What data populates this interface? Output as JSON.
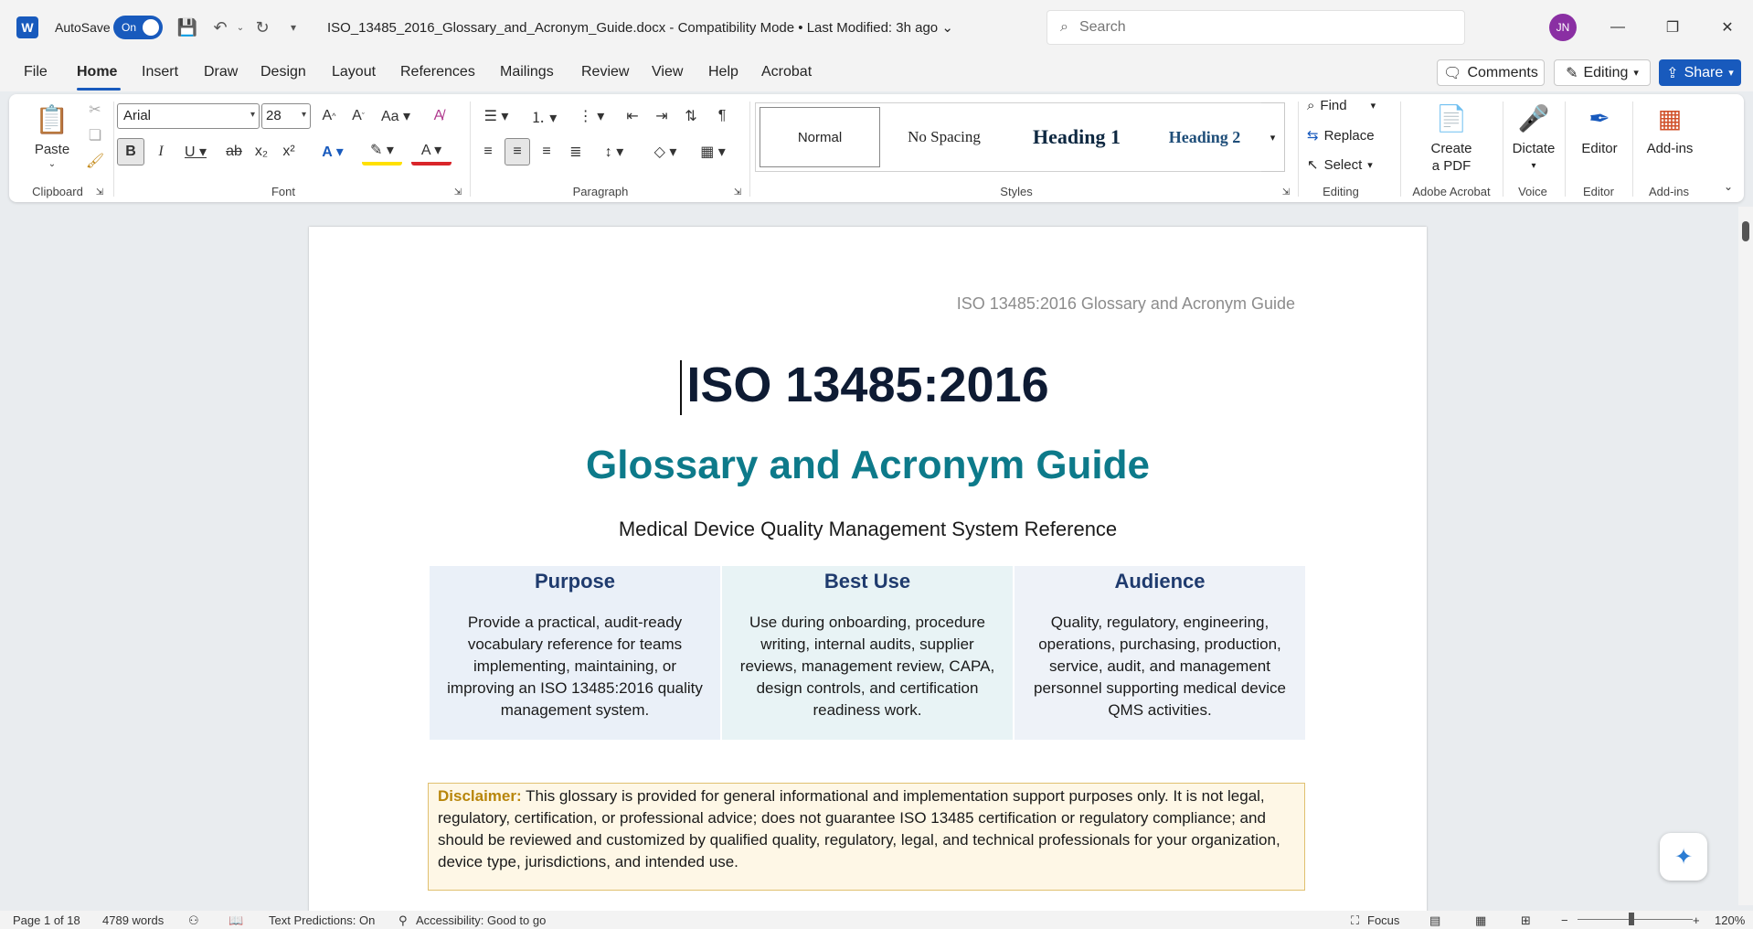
{
  "titlebar": {
    "autosave_label": "AutoSave",
    "autosave_state": "On",
    "document_name": "ISO_13485_2016_Glossary_and_Acronym_Guide.docx  -  Compatibility Mode  •  Last Modified: 3h ago",
    "search_placeholder": "Search",
    "user_initials": "JN"
  },
  "menu": {
    "tabs": [
      "File",
      "Home",
      "Insert",
      "Draw",
      "Design",
      "Layout",
      "References",
      "Mailings",
      "Review",
      "View",
      "Help",
      "Acrobat"
    ],
    "comments_label": "Comments",
    "editing_label": "Editing",
    "share_label": "Share"
  },
  "ribbon": {
    "clipboard": {
      "paste_label": "Paste",
      "group_label": "Clipboard"
    },
    "font": {
      "font_name": "Arial",
      "font_size": "28",
      "group_label": "Font"
    },
    "paragraph": {
      "group_label": "Paragraph"
    },
    "styles": {
      "items": [
        "Normal",
        "No Spacing",
        "Heading 1",
        "Heading 2"
      ],
      "group_label": "Styles"
    },
    "editing": {
      "find_label": "Find",
      "replace_label": "Replace",
      "select_label": "Select",
      "group_label": "Editing"
    },
    "acrobat": {
      "create_pdf_line1": "Create",
      "create_pdf_line2": "a PDF",
      "group_label": "Adobe Acrobat"
    },
    "voice": {
      "dictate_label": "Dictate",
      "group_label": "Voice"
    },
    "editor": {
      "editor_label": "Editor",
      "group_label": "Editor"
    },
    "addins": {
      "addins_label": "Add-ins",
      "group_label": "Add-ins"
    }
  },
  "document": {
    "running_header": "ISO 13485:2016 Glossary and Acronym Guide",
    "title": "ISO 13485:2016",
    "subtitle": "Glossary and Acronym Guide",
    "tagline": "Medical Device Quality Management System Reference",
    "info_cells": [
      {
        "heading": "Purpose",
        "body": "Provide a practical, audit-ready vocabulary reference for teams implementing, maintaining, or improving an ISO 13485:2016 quality management system.",
        "bg": "#eaf0f8"
      },
      {
        "heading": "Best Use",
        "body": "Use during onboarding, procedure writing, internal audits, supplier reviews, management review, CAPA, design controls, and certification readiness work.",
        "bg": "#e8f3f5"
      },
      {
        "heading": "Audience",
        "body": "Quality, regulatory, engineering, operations, purchasing, production, service, audit, and management personnel supporting medical device QMS activities.",
        "bg": "#eef2f8"
      }
    ],
    "disclaimer_label": "Disclaimer:",
    "disclaimer_text": " This glossary is provided for general informational and implementation support purposes only. It is not legal, regulatory, certification, or professional advice; does not guarantee ISO 13485 certification or regulatory compliance; and should be reviewed and customized by qualified quality, regulatory, legal, and technical professionals for your organization, device type, jurisdictions, and intended use."
  },
  "statusbar": {
    "page": "Page 1 of 18",
    "words": "4789 words",
    "text_predictions": "Text Predictions: On",
    "accessibility": "Accessibility: Good to go",
    "focus": "Focus",
    "zoom": "120%"
  },
  "colors": {
    "accent": "#185abd",
    "title": "#0e1b33",
    "subtitle": "#0d7a8a"
  }
}
